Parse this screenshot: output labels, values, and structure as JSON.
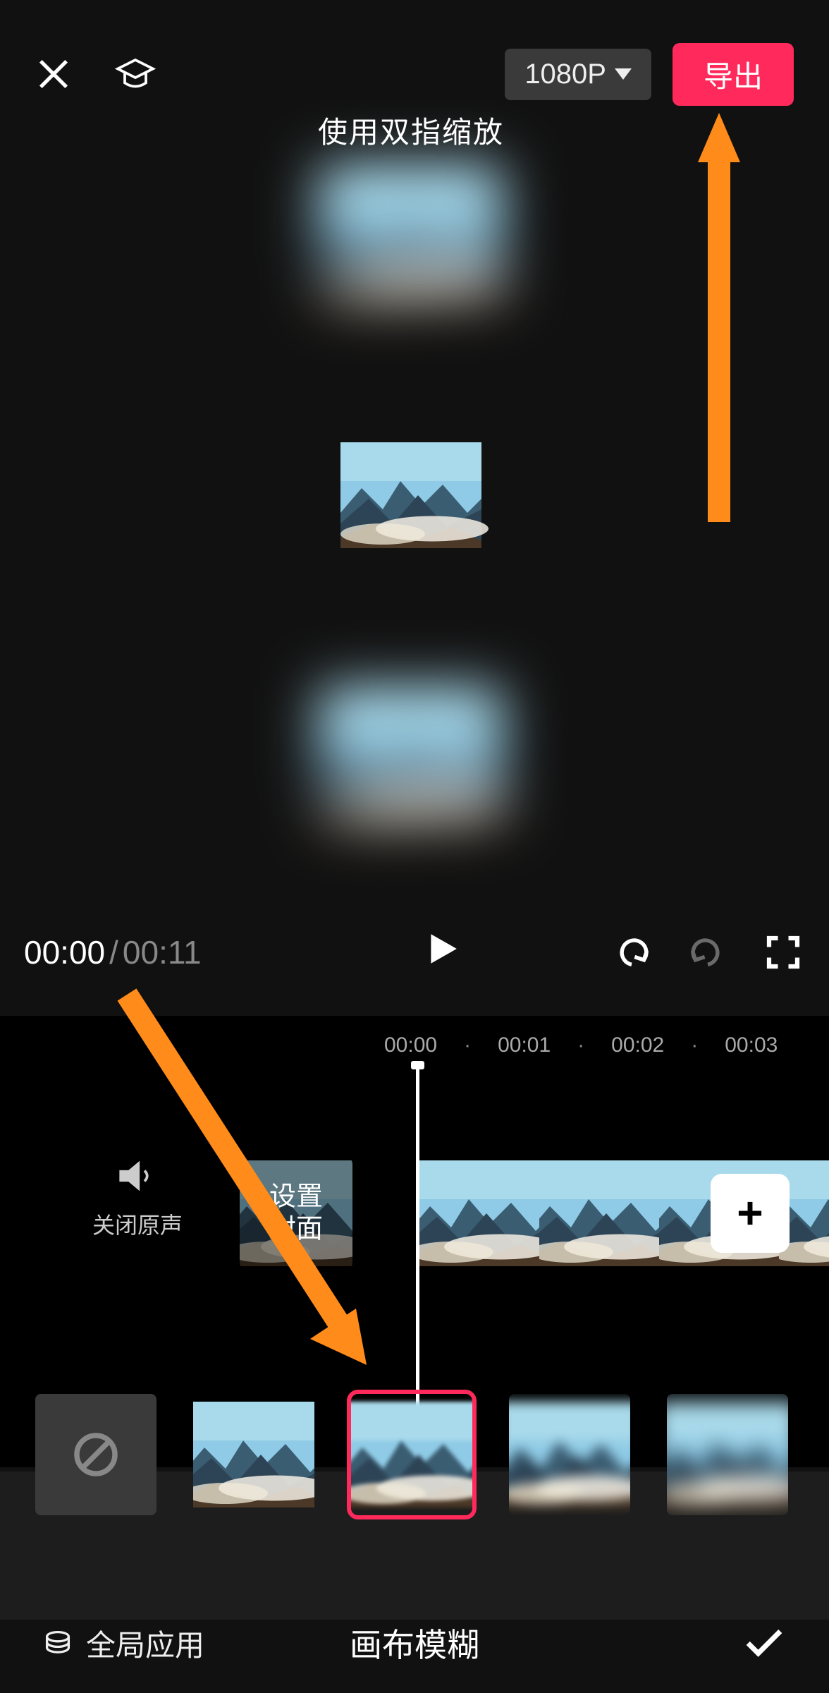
{
  "header": {
    "quality_label": "1080P",
    "export_label": "导出"
  },
  "preview": {
    "hint": "使用双指缩放"
  },
  "playback": {
    "current_time": "00:00",
    "total_time": "00:11"
  },
  "ruler_ticks": [
    "00:00",
    "·",
    "00:01",
    "·",
    "00:02",
    "·",
    "00:03"
  ],
  "mute": {
    "label": "关闭原声"
  },
  "cover": {
    "label": "设置\n封面"
  },
  "blur_options": {
    "selected_index": 1,
    "items": [
      "none",
      "blur-0",
      "blur-1",
      "blur-2",
      "blur-3"
    ]
  },
  "bottom": {
    "global_apply": "全局应用",
    "panel_title": "画布模糊"
  },
  "icons": {
    "close": "close-icon",
    "tutorial": "graduation-cap-icon",
    "play": "play-icon",
    "undo": "undo-icon",
    "redo": "redo-icon",
    "fullscreen": "fullscreen-icon",
    "mute": "mute-icon",
    "add": "plus-icon",
    "none": "no-symbol-icon",
    "stack": "stack-icon",
    "check": "check-icon"
  },
  "colors": {
    "accent": "#ff2a5b",
    "annotation": "#ff8c1a"
  }
}
